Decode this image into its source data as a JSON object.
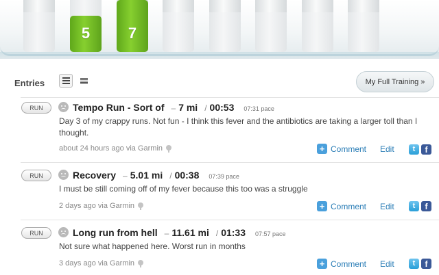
{
  "calendar": {
    "days": [
      {
        "value": "",
        "fill": 0
      },
      {
        "value": "5",
        "fill": 0.7
      },
      {
        "value": "7",
        "fill": 1.0
      },
      {
        "value": "",
        "fill": 0
      },
      {
        "value": "",
        "fill": 0
      },
      {
        "value": "",
        "fill": 0
      },
      {
        "value": "",
        "fill": 0
      },
      {
        "value": "",
        "fill": 0
      }
    ]
  },
  "entries_header": {
    "label": "Entries",
    "full_training_label": "My Full Training »"
  },
  "entries": [
    {
      "type": "RUN",
      "title": "Tempo Run - Sort of",
      "distance": "7 mi",
      "duration": "00:53",
      "pace": "07:31 pace",
      "description": "Day 3 of my crappy runs. Not fun - I think this fever and the antibiotics are taking a larger toll than I thought.",
      "meta": "about 24 hours ago via Garmin",
      "comment_label": "Comment",
      "edit_label": "Edit"
    },
    {
      "type": "RUN",
      "title": "Recovery",
      "distance": "5.01 mi",
      "duration": "00:38",
      "pace": "07:39 pace",
      "description": "I must be still coming off of my fever because this too was a struggle",
      "meta": "2 days ago via Garmin",
      "comment_label": "Comment",
      "edit_label": "Edit"
    },
    {
      "type": "RUN",
      "title": "Long run from hell",
      "distance": "11.61 mi",
      "duration": "01:33",
      "pace": "07:57 pace",
      "description": "Not sure what happened here. Worst run in months",
      "meta": "3 days ago via Garmin",
      "comment_label": "Comment",
      "edit_label": "Edit"
    }
  ],
  "icons": {
    "twitter": "twitter-icon",
    "facebook": "facebook-icon",
    "comment": "plus-icon",
    "location": "location-pin-icon",
    "mood": "sad-face-icon"
  },
  "colors": {
    "accent_green": "#7cc42a",
    "link_blue": "#2a7db6",
    "facebook_blue": "#3b5998",
    "twitter_blue": "#2a9fd8"
  }
}
